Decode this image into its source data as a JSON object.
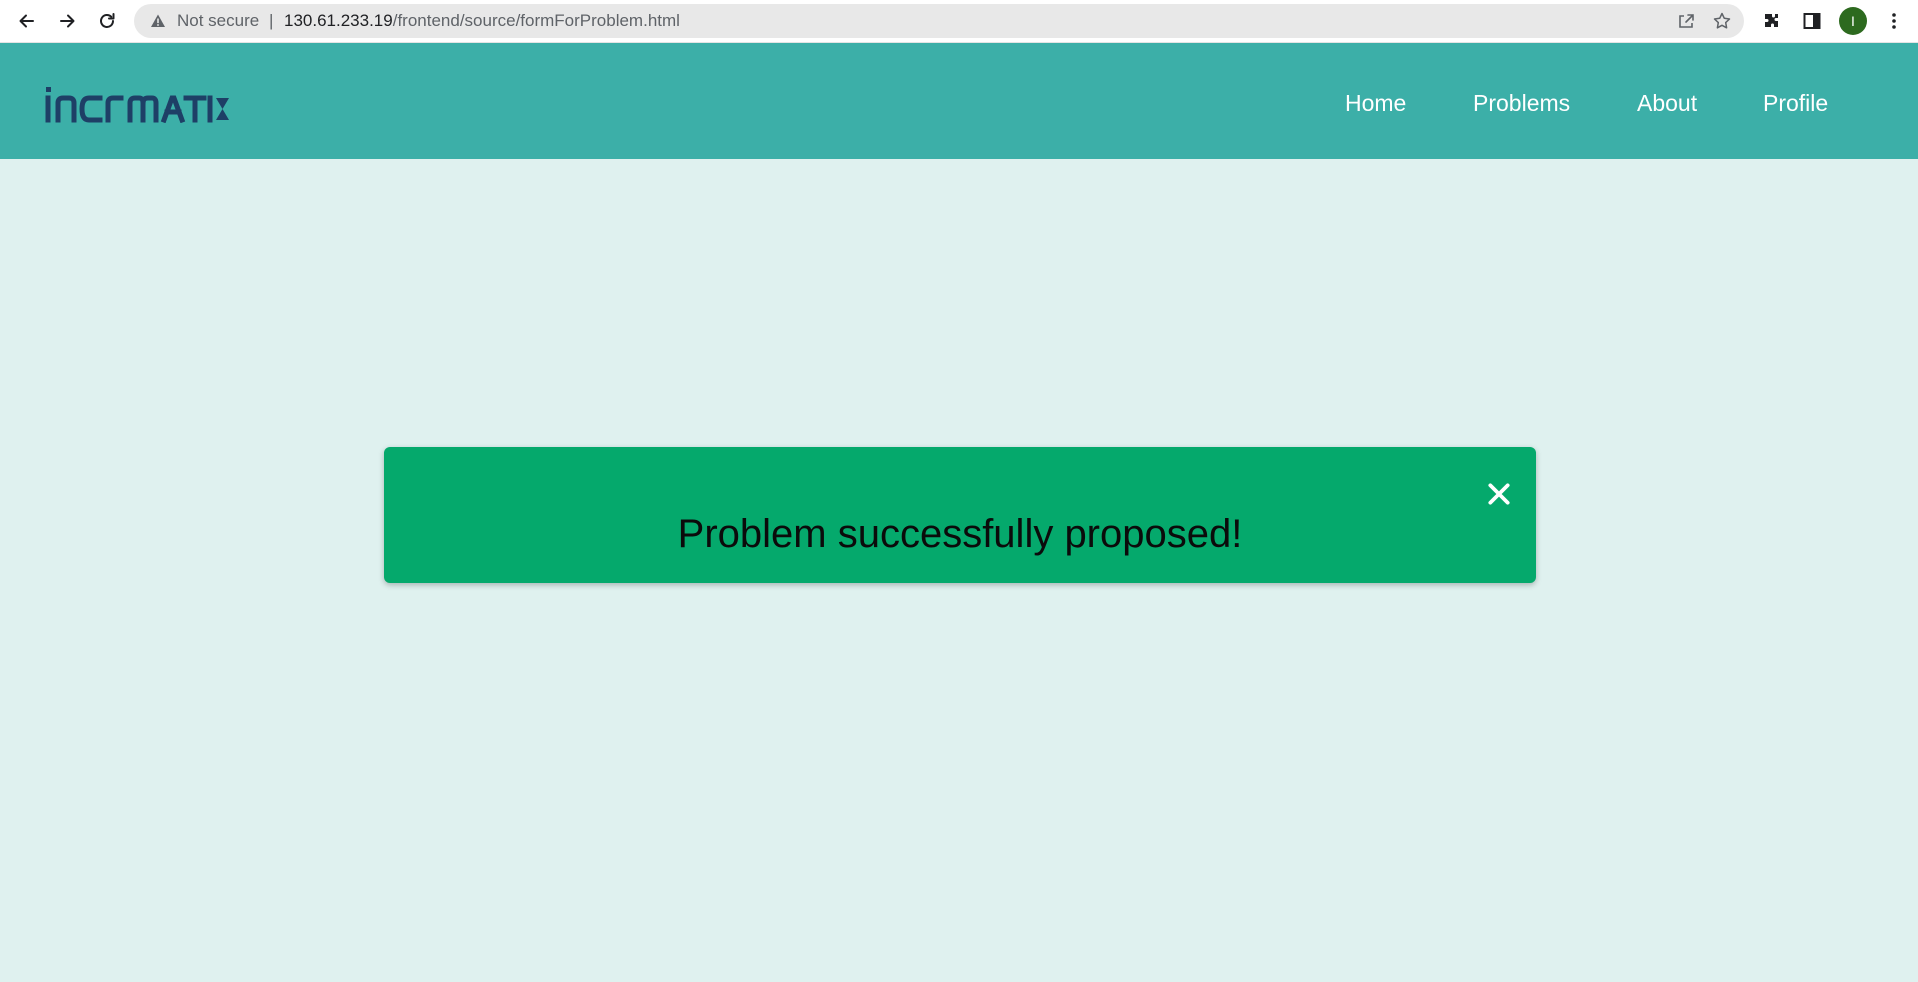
{
  "browser": {
    "security_label": "Not secure",
    "separator": "|",
    "url_host": "130.61.233.19",
    "url_path": "/frontend/source/formForProblem.html",
    "profile_initial": "I",
    "profile_color": "#2d6a1f"
  },
  "site": {
    "logo_text": "informatix",
    "brand_color": "#3cafa8",
    "logo_color": "#1e3f66",
    "nav": [
      {
        "label": "Home"
      },
      {
        "label": "Problems"
      },
      {
        "label": "About"
      },
      {
        "label": "Profile"
      }
    ]
  },
  "alert": {
    "message": "Problem successfully proposed!",
    "color": "#05a96c",
    "close_icon": "close-icon"
  },
  "page": {
    "background": "#dff1ef"
  }
}
